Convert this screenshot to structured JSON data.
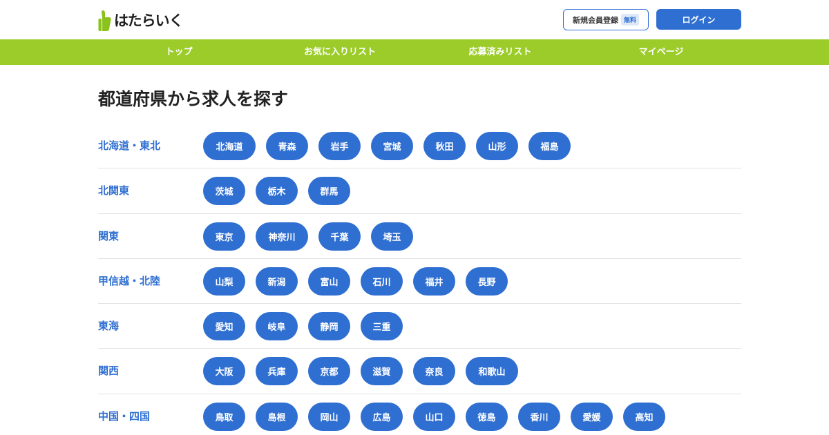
{
  "header": {
    "logo_text": "はたらいく",
    "logo_icon": "thumbs-up-icon",
    "signup_label": "新規会員登録",
    "free_badge": "無料",
    "login_label": "ログイン"
  },
  "nav": {
    "items": [
      {
        "label": "トップ"
      },
      {
        "label": "お気に入りリスト"
      },
      {
        "label": "応募済みリスト"
      },
      {
        "label": "マイページ"
      }
    ]
  },
  "main": {
    "title": "都道府県から求人を探す",
    "regions": [
      {
        "name": "北海道・東北",
        "prefectures": [
          "北海道",
          "青森",
          "岩手",
          "宮城",
          "秋田",
          "山形",
          "福島"
        ]
      },
      {
        "name": "北関東",
        "prefectures": [
          "茨城",
          "栃木",
          "群馬"
        ]
      },
      {
        "name": "関東",
        "prefectures": [
          "東京",
          "神奈川",
          "千葉",
          "埼玉"
        ]
      },
      {
        "name": "甲信越・北陸",
        "prefectures": [
          "山梨",
          "新潟",
          "富山",
          "石川",
          "福井",
          "長野"
        ]
      },
      {
        "name": "東海",
        "prefectures": [
          "愛知",
          "岐阜",
          "静岡",
          "三重"
        ]
      },
      {
        "name": "関西",
        "prefectures": [
          "大阪",
          "兵庫",
          "京都",
          "滋賀",
          "奈良",
          "和歌山"
        ]
      },
      {
        "name": "中国・四国",
        "prefectures": [
          "鳥取",
          "島根",
          "岡山",
          "広島",
          "山口",
          "徳島",
          "香川",
          "愛媛",
          "高知"
        ]
      }
    ]
  },
  "colors": {
    "brand_green": "#9ccc2a",
    "accent_blue": "#2f6fd1"
  }
}
